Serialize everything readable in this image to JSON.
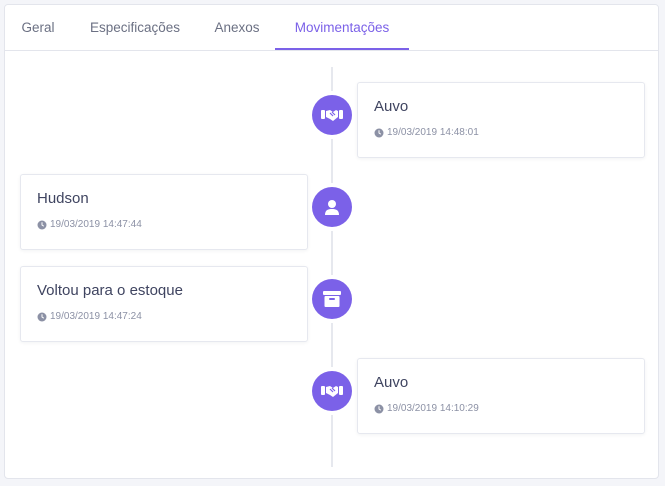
{
  "tabs": [
    {
      "label": "Geral"
    },
    {
      "label": "Especificações"
    },
    {
      "label": "Anexos"
    },
    {
      "label": "Movimentações",
      "active": true
    }
  ],
  "timeline": {
    "events": [
      {
        "title": "Auvo",
        "time": "19/03/2019 14:48:01",
        "icon": "handshake-icon",
        "side": "right"
      },
      {
        "title": "Hudson",
        "time": "19/03/2019 14:47:44",
        "icon": "user-icon",
        "side": "left"
      },
      {
        "title": "Voltou para o estoque",
        "time": "19/03/2019 14:47:24",
        "icon": "archive-box-icon",
        "side": "left"
      },
      {
        "title": "Auvo",
        "time": "19/03/2019 14:10:29",
        "icon": "handshake-icon",
        "side": "right"
      }
    ]
  },
  "colors": {
    "accent": "#7b61e8",
    "text": "#3f4460",
    "muted": "#8c91a5"
  }
}
